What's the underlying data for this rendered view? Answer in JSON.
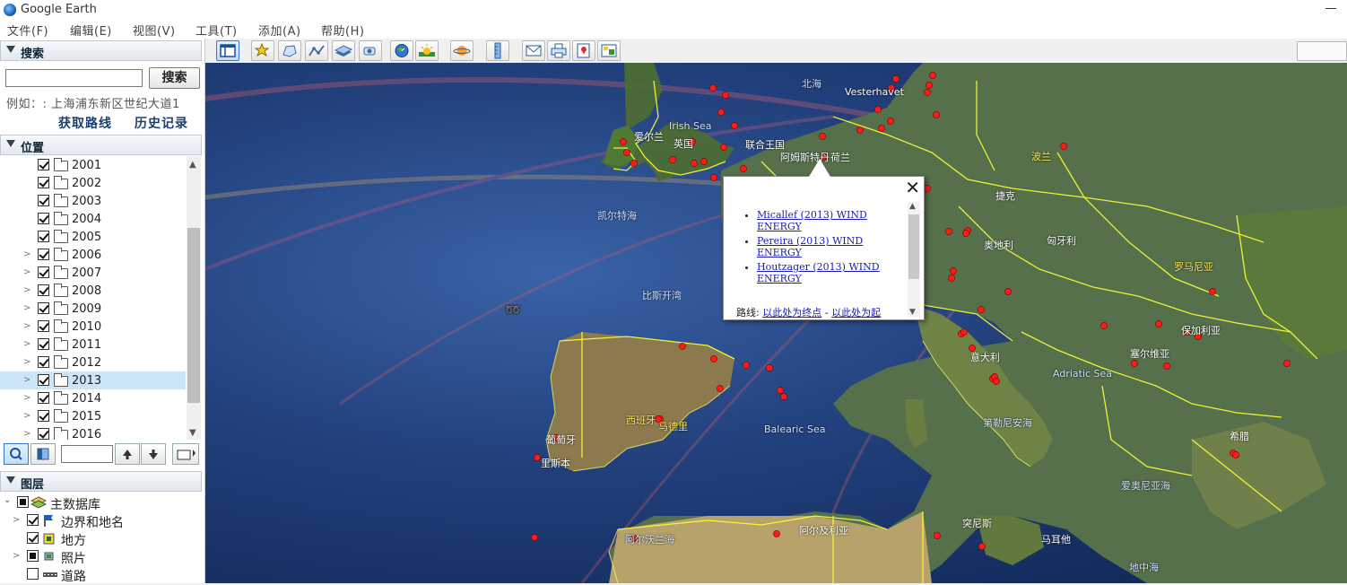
{
  "titlebar": {
    "title": "Google Earth"
  },
  "menu": [
    "文件(F)",
    "编辑(E)",
    "视图(V)",
    "工具(T)",
    "添加(A)",
    "帮助(H)"
  ],
  "search": {
    "header": "搜索",
    "button": "搜索",
    "input_value": "",
    "example": "例如：: 上海浦东新区世纪大道1",
    "link_route": "获取路线",
    "link_history": "历史记录"
  },
  "places": {
    "header": "位置",
    "items": [
      {
        "label": "2001",
        "checked": true,
        "expandable": false
      },
      {
        "label": "2002",
        "checked": true,
        "expandable": false
      },
      {
        "label": "2003",
        "checked": true,
        "expandable": false
      },
      {
        "label": "2004",
        "checked": true,
        "expandable": false
      },
      {
        "label": "2005",
        "checked": true,
        "expandable": false
      },
      {
        "label": "2006",
        "checked": true,
        "expandable": true
      },
      {
        "label": "2007",
        "checked": true,
        "expandable": true
      },
      {
        "label": "2008",
        "checked": true,
        "expandable": true
      },
      {
        "label": "2009",
        "checked": true,
        "expandable": true
      },
      {
        "label": "2010",
        "checked": true,
        "expandable": true
      },
      {
        "label": "2011",
        "checked": true,
        "expandable": true
      },
      {
        "label": "2012",
        "checked": true,
        "expandable": true
      },
      {
        "label": "2013",
        "checked": true,
        "expandable": true,
        "selected": true
      },
      {
        "label": "2014",
        "checked": true,
        "expandable": true
      },
      {
        "label": "2015",
        "checked": true,
        "expandable": true
      },
      {
        "label": "2016",
        "checked": true,
        "expandable": true
      }
    ]
  },
  "layers": {
    "header": "图层",
    "items": [
      {
        "label": "主数据库"
      },
      {
        "label": "边界和地名"
      },
      {
        "label": "地方"
      },
      {
        "label": "照片"
      },
      {
        "label": "道路"
      }
    ]
  },
  "popup": {
    "items": [
      "Micallef (2013) WIND ENERGY",
      "Pereira (2013) WIND ENERGY",
      "Houtzager (2013) WIND ENERGY"
    ],
    "route_label": "路线:",
    "route_to": "以此处为终点",
    "route_sep": " - ",
    "route_from": "以此处为起"
  },
  "map_labels": [
    {
      "text": "北海"
    },
    {
      "text": "Vesterhavet"
    },
    {
      "text": "Irish Sea"
    },
    {
      "text": "爱尔兰"
    },
    {
      "text": "英国"
    },
    {
      "text": "联合王国"
    },
    {
      "text": "阿姆斯特丹"
    },
    {
      "text": "荷兰"
    },
    {
      "text": "凯尔特海"
    },
    {
      "text": "比斯开湾"
    },
    {
      "text": "波兰"
    },
    {
      "text": "捷克"
    },
    {
      "text": "奥地利"
    },
    {
      "text": "匈牙利"
    },
    {
      "text": "罗马尼亚"
    },
    {
      "text": "意大利"
    },
    {
      "text": "Adriatic Sea"
    },
    {
      "text": "塞尔维亚"
    },
    {
      "text": "保加利亚"
    },
    {
      "text": "西班牙"
    },
    {
      "text": "马德里"
    },
    {
      "text": "葡萄牙"
    },
    {
      "text": "里斯本"
    },
    {
      "text": "Balearic Sea"
    },
    {
      "text": "第勒尼安海"
    },
    {
      "text": "希腊"
    },
    {
      "text": "爱奥尼亚海"
    },
    {
      "text": "阿尔及利亚"
    },
    {
      "text": "阿尔沃兰海"
    },
    {
      "text": "突尼斯"
    },
    {
      "text": "马耳他"
    },
    {
      "text": "地中海"
    }
  ],
  "colors": {
    "pin": "#ff1a1a",
    "border": "#ffff33",
    "ocean": "#213f7a",
    "land": "#4d6b35"
  }
}
